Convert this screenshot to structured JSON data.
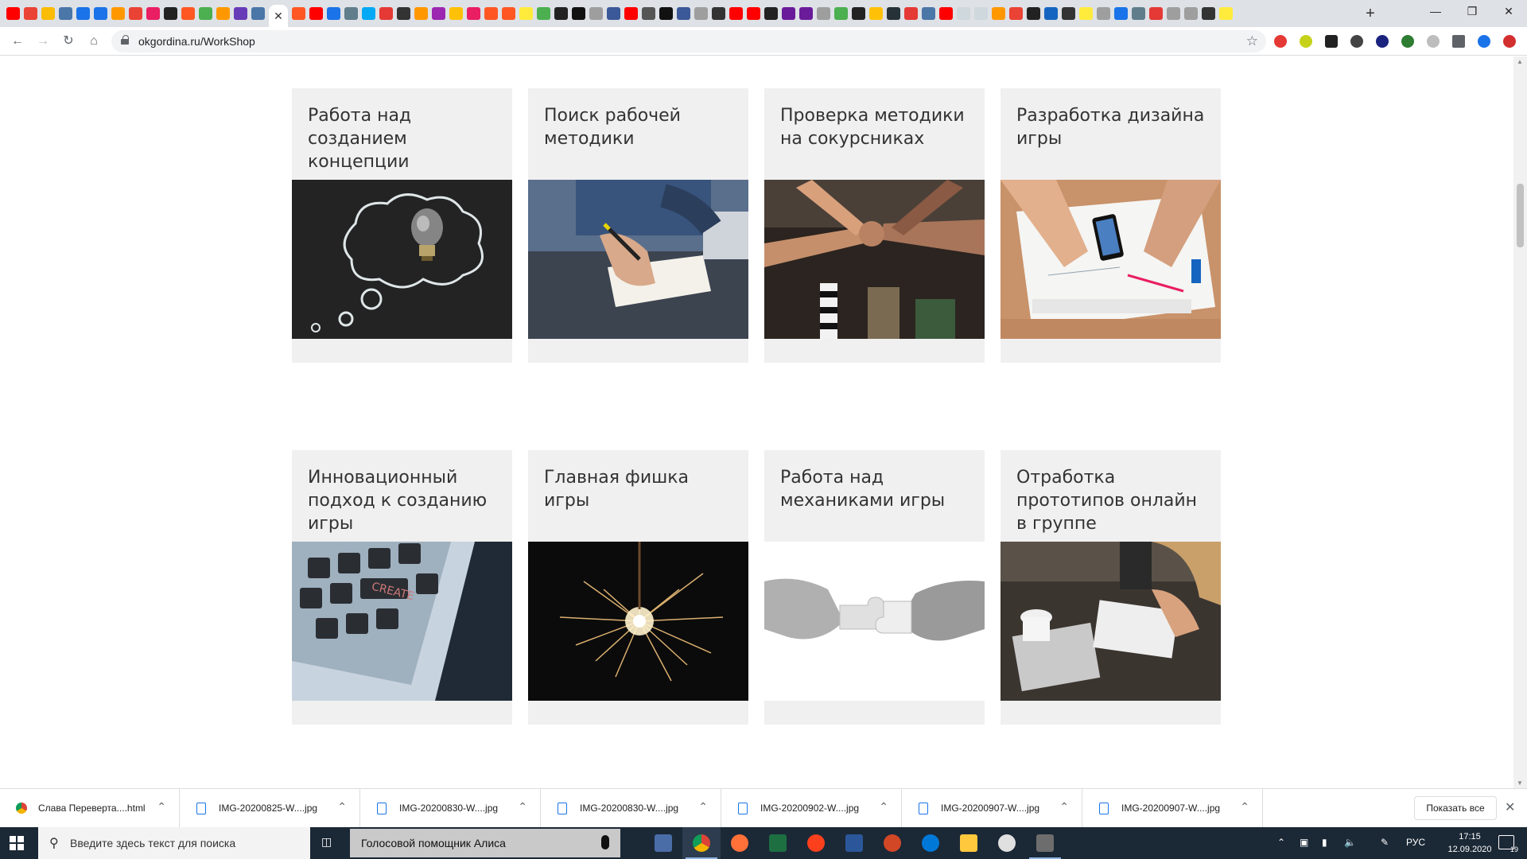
{
  "browser": {
    "address": "okgordina.ru/WorkShop",
    "new_tab": "+",
    "close_tab": "✕",
    "controls": {
      "minimize": "—",
      "restore": "❐",
      "close": "✕"
    }
  },
  "cards": [
    {
      "title": "Работа над созданием концепции",
      "image": "lightbulb-chalkboard"
    },
    {
      "title": "Поиск рабочей методики",
      "image": "hand-writing-notebook"
    },
    {
      "title": "Проверка методики на сокурсниках",
      "image": "team-fist-bump"
    },
    {
      "title": "Разработка дизайна игры",
      "image": "design-desk-phone"
    },
    {
      "title": "Инновационный подход к созданию игры",
      "image": "keyboard-create-key"
    },
    {
      "title": "Главная фишка игры",
      "image": "sparkler"
    },
    {
      "title": "Работа над механиками игры",
      "image": "puzzle-pieces-hands"
    },
    {
      "title": "Отработка прототипов онлайн в группе",
      "image": "team-laptop-coffee"
    }
  ],
  "downloads": {
    "items": [
      {
        "name": "Слава Переверта....html",
        "type": "chrome"
      },
      {
        "name": "IMG-20200825-W....jpg",
        "type": "file"
      },
      {
        "name": "IMG-20200830-W....jpg",
        "type": "file"
      },
      {
        "name": "IMG-20200830-W....jpg",
        "type": "file"
      },
      {
        "name": "IMG-20200902-W....jpg",
        "type": "file"
      },
      {
        "name": "IMG-20200907-W....jpg",
        "type": "file"
      },
      {
        "name": "IMG-20200907-W....jpg",
        "type": "file"
      }
    ],
    "show_all": "Показать все"
  },
  "taskbar": {
    "search_placeholder": "Введите здесь текст для поиска",
    "alice": "Голосовой помощник Алиса",
    "apps": [
      "calculator",
      "chrome",
      "firefox",
      "excel",
      "yandex-browser",
      "word",
      "powerpoint",
      "edge",
      "file-explorer",
      "settings",
      "video-editor"
    ],
    "lang": "РУС",
    "time": "17:15",
    "date": "12.09.2020",
    "notifications": "19"
  },
  "colors": {
    "card_bg": "#f0f0f0",
    "title_text": "#333333",
    "taskbar": "#1b2836",
    "accent": "#1a73e8"
  }
}
